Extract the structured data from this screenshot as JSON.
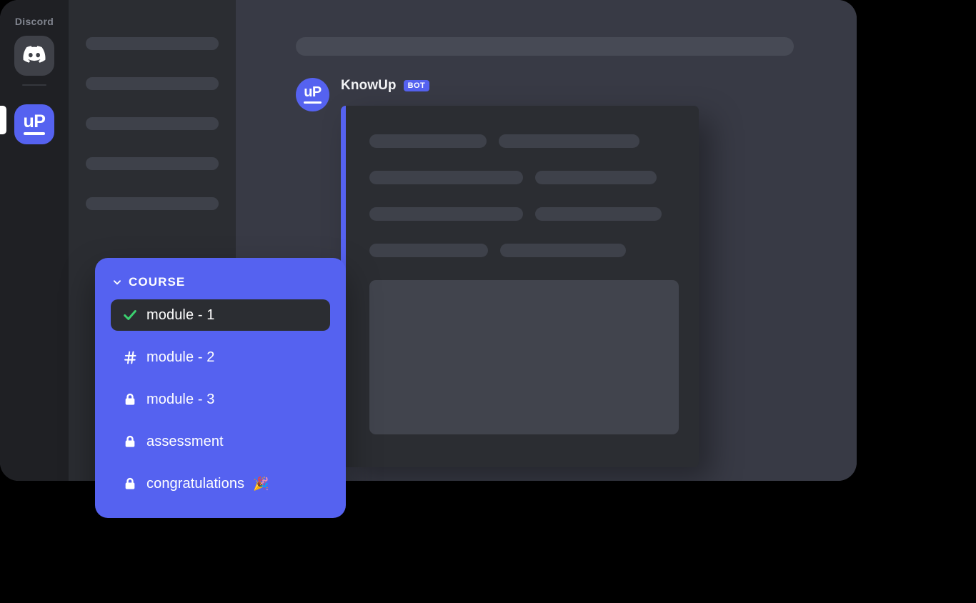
{
  "theme": {
    "canvas_bg": "#000000",
    "window_bg": "#383a45",
    "rail_bg": "#1f2024",
    "sidebar_bg": "#2b2d32",
    "accent_purple": "#5562f0",
    "skeleton_gray": "#3e414a",
    "skeleton_light": "#474a55",
    "check_green": "#3bd16f",
    "text_white": "#ffffff",
    "brand_label_gray": "#81858f"
  },
  "server_rail": {
    "brand_label": "Discord",
    "servers": [
      {
        "name": "discord-server",
        "icon": "discord-logo-icon",
        "active": false
      },
      {
        "name": "knowup-server",
        "icon": "up-logo-icon",
        "logo_text": "uP",
        "active": true
      }
    ]
  },
  "channel_sidebar": {
    "skeleton_items": [
      1,
      2,
      3,
      4,
      5
    ]
  },
  "chat": {
    "topbar_skeleton": true,
    "message": {
      "author": "KnowUp",
      "badge": "BOT",
      "avatar_icon": "up-logo-icon",
      "avatar_text": "uP"
    },
    "embed": {
      "accent_color": "#5562f0",
      "field_rows": [
        {
          "left_width": 164,
          "right_width": 197
        },
        {
          "left_width": 215,
          "right_width": 170
        },
        {
          "left_width": 215,
          "right_width": 177
        },
        {
          "left_width": 166,
          "right_width": 176
        }
      ],
      "image_placeholder": true
    }
  },
  "course_panel": {
    "header": {
      "label": "COURSE",
      "chevron": "chevron-down-icon",
      "expanded": true
    },
    "items": [
      {
        "label": "module - 1",
        "icon": "check-icon",
        "state": "completed",
        "active": true,
        "emoji": ""
      },
      {
        "label": "module - 2",
        "icon": "hash-icon",
        "state": "unlocked",
        "active": false,
        "emoji": ""
      },
      {
        "label": "module - 3",
        "icon": "lock-icon",
        "state": "locked",
        "active": false,
        "emoji": ""
      },
      {
        "label": "assessment",
        "icon": "lock-icon",
        "state": "locked",
        "active": false,
        "emoji": ""
      },
      {
        "label": "congratulations",
        "icon": "lock-icon",
        "state": "locked",
        "active": false,
        "emoji": "🎉"
      }
    ]
  }
}
